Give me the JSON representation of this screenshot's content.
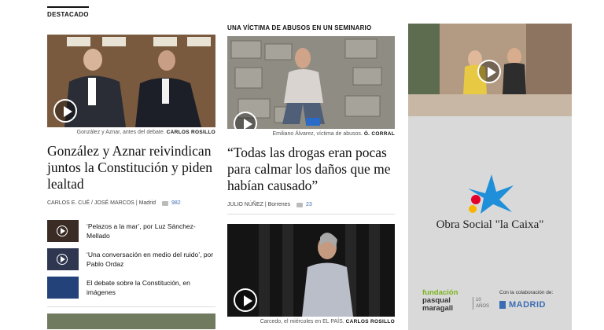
{
  "section": {
    "label": "DESTACADO"
  },
  "story1": {
    "caption": "González y Aznar, antes del debate.",
    "credit": "CARLOS ROSILLO",
    "headline": "González y Aznar reivindican juntos la Constitución y piden lealtad",
    "authors": "CARLOS E. CUÉ / JOSÉ MARCOS",
    "location": "| Madrid",
    "comments": "982"
  },
  "related": [
    {
      "text": "‘Pelazos a la mar’, por Luz Sánchez-Mellado"
    },
    {
      "text": "‘Una conversación en medio del ruido’, por Pablo Ordaz"
    },
    {
      "text": "El debate sobre la Constitución, en imágenes"
    }
  ],
  "story2": {
    "kicker": "UNA VÍCTIMA DE ABUSOS EN UN SEMINARIO",
    "caption": "Emiliano Álvarez, víctima de abusos.",
    "credit": "Ó. CORRAL",
    "headline": "“Todas las drogas eran pocas para calmar los daños que me habían causado”",
    "authors": "JULIO NÚÑEZ",
    "location": "| Borrenes",
    "comments": "23"
  },
  "story3": {
    "caption": "Carcedo, el miércoles en EL PAÍS.",
    "credit": "CARLOS ROSILLO"
  },
  "ad": {
    "brand": "Obra Social \"la Caixa\"",
    "partner_line1": "fundación",
    "partner_line2": "pasqual",
    "partner_line3": "maragall",
    "years": "10 AÑOS",
    "collab_label": "Con la colaboración de:",
    "city": "MADRID"
  },
  "colors": {
    "link": "#3b6db3",
    "caixa_blue": "#1e8fd8",
    "caixa_red": "#e4002b",
    "caixa_yellow": "#f7b500",
    "maragall_green": "#7ab51d"
  }
}
